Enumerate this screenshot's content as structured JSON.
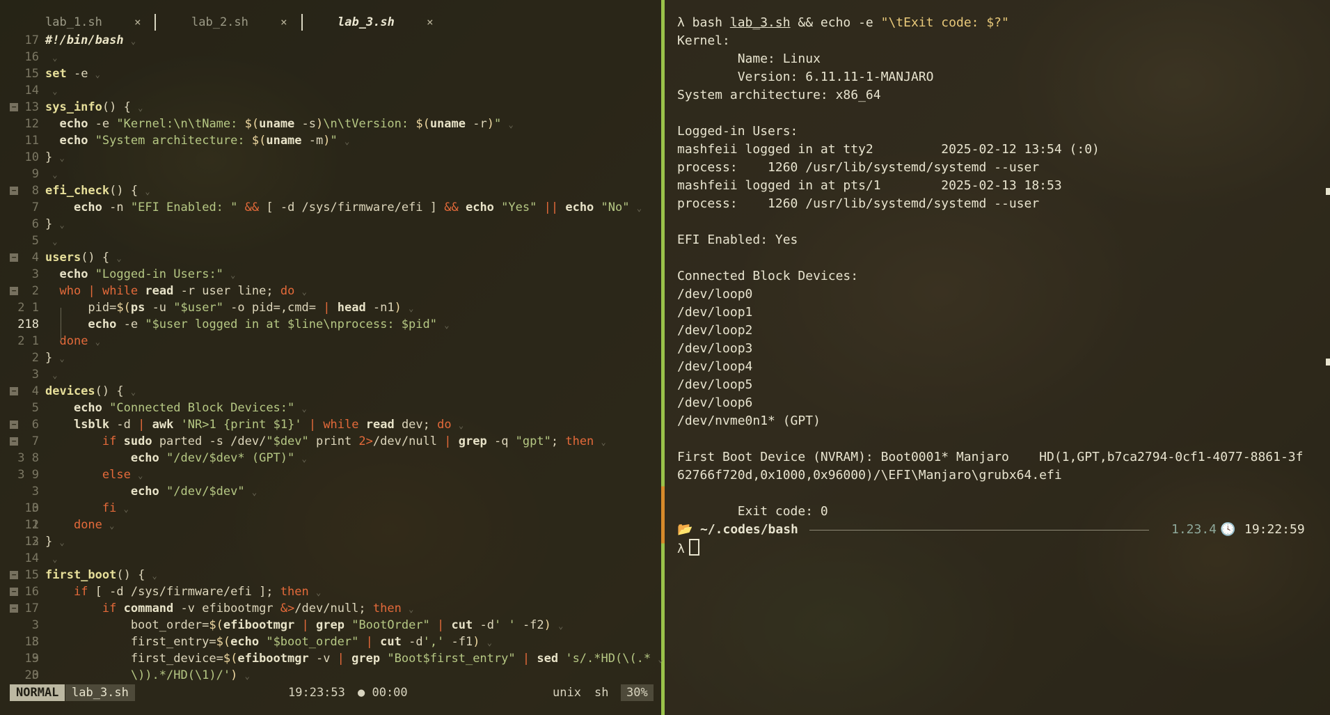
{
  "tabs": [
    {
      "label": "lab_1.sh",
      "close": "×"
    },
    {
      "label": "lab_2.sh",
      "close": "×"
    },
    {
      "label": "lab_3.sh",
      "close": "×",
      "active": true
    }
  ],
  "code_lines": [
    {
      "ln": "17",
      "fold": "",
      "html": "<span class='c'>#!/bin/bash</span>"
    },
    {
      "ln": "16",
      "fold": "",
      "html": ""
    },
    {
      "ln": "15",
      "fold": "",
      "html": "<span class='fn'>set</span> -e"
    },
    {
      "ln": "14",
      "fold": "",
      "html": ""
    },
    {
      "ln": "13",
      "fold": "−",
      "html": "<span class='fn'>sys_info</span>() {"
    },
    {
      "ln": "12",
      "fold": "",
      "html": "  <span class='b'>echo</span> -e <span class='s'>\"Kernel:\\n\\tName: </span><span class='v'>$(</span><span class='b'>uname</span> -s<span class='v'>)</span><span class='s'>\\n\\tVersion: </span><span class='v'>$(</span><span class='b'>uname</span> -r<span class='v'>)</span><span class='s'>\"</span>"
    },
    {
      "ln": "11",
      "fold": "",
      "html": "  <span class='b'>echo</span> <span class='s'>\"System architecture: </span><span class='v'>$(</span><span class='b'>uname</span> -m<span class='v'>)</span><span class='s'>\"</span>"
    },
    {
      "ln": "10",
      "fold": "",
      "html": "}"
    },
    {
      "ln": "9",
      "fold": "",
      "html": ""
    },
    {
      "ln": "8",
      "fold": "−",
      "html": "<span class='fn'>efi_check</span>() {"
    },
    {
      "ln": "7",
      "fold": "",
      "html": "    <span class='b'>echo</span> -n <span class='s'>\"EFI Enabled: \"</span> <span class='k'>&amp;&amp;</span> [ -d /sys/firmware/efi ] <span class='k'>&amp;&amp;</span> <span class='b'>echo</span> <span class='s'>\"Yes\"</span> <span class='k'>||</span> <span class='b'>echo</span> <span class='s'>\"No\"</span>"
    },
    {
      "ln": "6",
      "fold": "",
      "html": "}"
    },
    {
      "ln": "5",
      "fold": "",
      "html": ""
    },
    {
      "ln": "4",
      "fold": "−",
      "html": "<span class='fn'>users</span>() {"
    },
    {
      "ln": "3",
      "fold": "",
      "html": "  <span class='b'>echo</span> <span class='s'>\"Logged-in Users:\"</span>"
    },
    {
      "ln": "2",
      "fold": "−",
      "html": "  <span class='k'>who</span> <span class='k'>|</span> <span class='k'>while</span> <span class='b'>read</span> -r user line; <span class='k'>do</span>"
    },
    {
      "ln": "2 1",
      "fold": "",
      "html": "      pid=<span class='v'>$(</span><span class='b'>ps</span> -u <span class='s'>\"$user\"</span> -o pid=,cmd= <span class='k'>|</span> <span class='b'>head</span> -n1<span class='v'>)</span>"
    },
    {
      "ln": "218",
      "fold": "",
      "html": "      <span class='b'>echo</span> -e <span class='s'>\"$user logged in at $line\\nprocess: $pid\"</span>",
      "current": true
    },
    {
      "ln": "2 1",
      "fold": "",
      "html": "  <span class='k'>done</span>"
    },
    {
      "ln": "2",
      "fold": "",
      "html": "}"
    },
    {
      "ln": "3",
      "fold": "",
      "html": ""
    },
    {
      "ln": "4",
      "fold": "−",
      "html": "<span class='fn'>devices</span>() {"
    },
    {
      "ln": "5",
      "fold": "",
      "html": "    <span class='b'>echo</span> <span class='s'>\"Connected Block Devices:\"</span>"
    },
    {
      "ln": "6",
      "fold": "−",
      "html": "    <span class='b'>lsblk</span> -d <span class='k'>|</span> <span class='b'>awk</span> <span class='s'>'NR&gt;1 {print $1}'</span> <span class='k'>|</span> <span class='k'>while</span> <span class='b'>read</span> dev; <span class='k'>do</span>"
    },
    {
      "ln": "7",
      "fold": "−",
      "html": "        <span class='k'>if</span> <span class='b'>sudo</span> parted -s /dev/<span class='s'>\"$dev\"</span> print <span class='k'>2&gt;</span>/dev/null <span class='k'>|</span> <span class='b'>grep</span> -q <span class='s'>\"gpt\"</span>; <span class='k'>then</span>"
    },
    {
      "ln": "3 8",
      "fold": "",
      "html": "            <span class='b'>echo</span> <span class='s'>\"/dev/$dev* (GPT)\"</span>"
    },
    {
      "ln": "3 9",
      "fold": "",
      "html": "        <span class='k'>else</span>"
    },
    {
      "ln": "3 10",
      "fold": "",
      "html": "            <span class='b'>echo</span> <span class='s'>\"/dev/$dev\"</span>"
    },
    {
      "ln": "3 11",
      "fold": "",
      "html": "        <span class='k'>fi</span>"
    },
    {
      "ln": "2 12",
      "fold": "",
      "html": "    <span class='k'>done</span>"
    },
    {
      "ln": "13",
      "fold": "",
      "html": "}"
    },
    {
      "ln": "14",
      "fold": "",
      "html": ""
    },
    {
      "ln": "15",
      "fold": "−",
      "html": "<span class='fn'>first_boot</span>() {"
    },
    {
      "ln": "16",
      "fold": "−",
      "html": "    <span class='k'>if</span> [ -d /sys/firmware/efi ]; <span class='k'>then</span>"
    },
    {
      "ln": "17",
      "fold": "−",
      "html": "        <span class='k'>if</span> <span class='b'>command</span> -v efibootmgr <span class='k'>&amp;&gt;</span>/dev/null; <span class='k'>then</span>"
    },
    {
      "ln": "3 18",
      "fold": "",
      "html": "            boot_order=<span class='v'>$(</span><span class='b'>efibootmgr</span> <span class='k'>|</span> <span class='b'>grep</span> <span class='s'>\"BootOrder\"</span> <span class='k'>|</span> <span class='b'>cut</span> -d<span class='s'>' '</span> -f2<span class='v'>)</span>"
    },
    {
      "ln": "3 19",
      "fold": "",
      "html": "            first_entry=<span class='v'>$(</span><span class='b'>echo</span> <span class='s'>\"$boot_order\"</span> <span class='k'>|</span> <span class='b'>cut</span> -d<span class='s'>','</span> -f1<span class='v'>)</span>"
    },
    {
      "ln": "3 20",
      "fold": "",
      "html": "            first_device=<span class='v'>$(</span><span class='b'>efibootmgr</span> -v <span class='k'>|</span> <span class='b'>grep</span> <span class='s'>\"Boot$first_entry\"</span> <span class='k'>|</span> <span class='b'>sed</span> <span class='s'>'s/.*HD(\\(.*</span>"
    },
    {
      "ln": "3",
      "fold": "",
      "html": "            <span class='s'>\\)).*/HD(\\1)/'</span><span class='v'>)</span>"
    }
  ],
  "status": {
    "mode": "NORMAL",
    "file": "lab_3.sh",
    "time": "19:23:53",
    "timer": "● 00:00",
    "format": "unix",
    "filetype": "sh",
    "percent": "30%"
  },
  "terminal": {
    "command_html": "λ bash <span class='u'>lab_3.sh</span> &amp;&amp; echo -e <span class='y'>\"\\tExit code: $?\"</span>",
    "lines": [
      "Kernel:",
      "        Name: Linux",
      "        Version: 6.11.11-1-MANJARO",
      "System architecture: x86_64",
      "",
      "Logged-in Users:",
      "mashfeii logged in at tty2         2025-02-12 13:54 (:0)",
      "process:    1260 /usr/lib/systemd/systemd --user",
      "mashfeii logged in at pts/1        2025-02-13 18:53",
      "process:    1260 /usr/lib/systemd/systemd --user",
      "",
      "EFI Enabled: Yes",
      "",
      "Connected Block Devices:",
      "/dev/loop0",
      "/dev/loop1",
      "/dev/loop2",
      "/dev/loop3",
      "/dev/loop4",
      "/dev/loop5",
      "/dev/loop6",
      "/dev/nvme0n1* (GPT)",
      "",
      "First Boot Device (NVRAM): Boot0001* Manjaro    HD(1,GPT,b7ca2794-0cf1-4077-8861-3f",
      "62766f720d,0x1000,0x96000)/\\EFI\\Manjaro\\grubx64.efi",
      "",
      "        Exit code: 0"
    ],
    "prompt": {
      "folder_icon": "📂",
      "path": "~/.codes/bash",
      "version": "1.23.4",
      "clock_icon": "🕓",
      "time": "19:22:59",
      "symbol": "λ"
    }
  },
  "colors": {
    "keyword": "#e46a3a",
    "string": "#b6c884",
    "accent_green": "#9ac24a",
    "accent_orange": "#d78a2a"
  }
}
